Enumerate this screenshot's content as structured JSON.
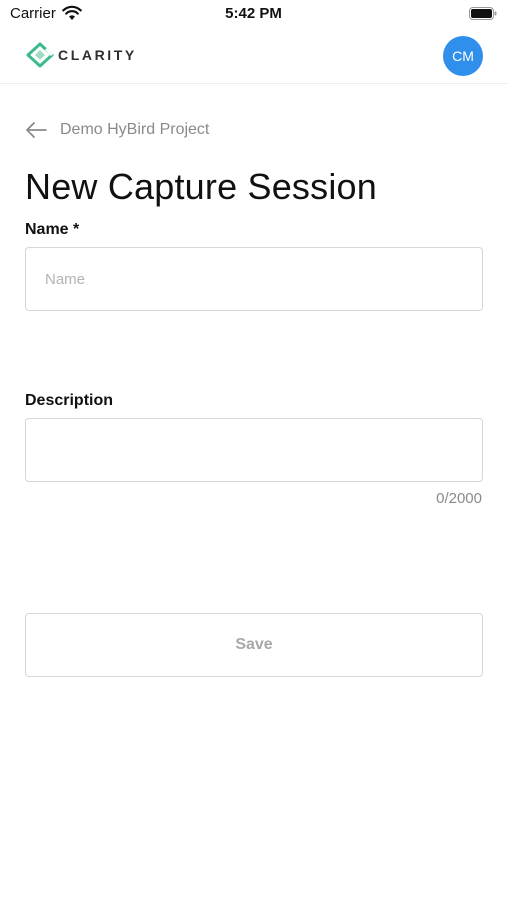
{
  "status_bar": {
    "carrier": "Carrier",
    "time": "5:42 PM"
  },
  "header": {
    "logo_text": "CLARITY",
    "avatar_initials": "CM",
    "avatar_color": "#2f8fea",
    "logo_color": "#3dba8c"
  },
  "breadcrumb": {
    "label": "Demo HyBird Project"
  },
  "page": {
    "title": "New Capture Session"
  },
  "form": {
    "name_label": "Name *",
    "name_placeholder": "Name",
    "name_value": "",
    "description_label": "Description",
    "description_value": "",
    "description_counter": "0/2000",
    "save_label": "Save"
  }
}
